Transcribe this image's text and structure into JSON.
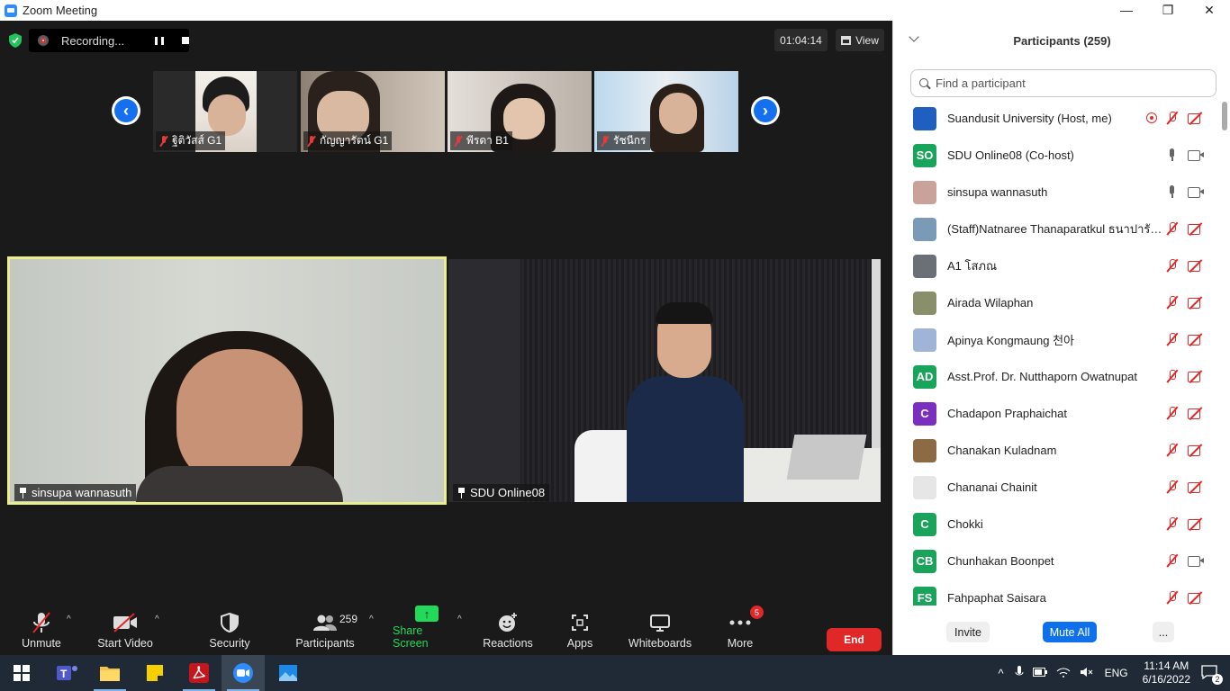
{
  "window": {
    "title": "Zoom Meeting",
    "controls": [
      "—",
      "❐",
      "✕"
    ]
  },
  "meeting": {
    "recording_label": "Recording...",
    "timer": "01:04:14",
    "view_label": "View",
    "thumbnails": [
      {
        "name": "ฐิติวัสส์ G1",
        "muted": true
      },
      {
        "name": "กัญญารัตน์ G1",
        "muted": true
      },
      {
        "name": "พีรดา B1",
        "muted": true
      },
      {
        "name": "รัชนีกร",
        "muted": true
      }
    ],
    "speakers": [
      {
        "name": "sinsupa wannasuth",
        "active": true
      },
      {
        "name": "SDU Online08",
        "active": false
      }
    ]
  },
  "toolbar": {
    "unmute": "Unmute",
    "start_video": "Start Video",
    "security": "Security",
    "participants": "Participants",
    "participants_count": "259",
    "share_screen": "Share Screen",
    "reactions": "Reactions",
    "apps": "Apps",
    "whiteboards": "Whiteboards",
    "more": "More",
    "more_badge": "5",
    "end": "End"
  },
  "panel": {
    "title": "Participants (259)",
    "search_placeholder": "Find a participant",
    "participants": [
      {
        "name": "Suandusit University (Host, me)",
        "initials": "",
        "avatar_color": "#1f5fbf",
        "mic": "off",
        "cam": "off",
        "recording": true
      },
      {
        "name": "SDU Online08 (Co-host)",
        "initials": "SO",
        "avatar_color": "#1aa35a",
        "mic": "on",
        "cam": "on",
        "recording": false
      },
      {
        "name": "sinsupa wannasuth",
        "initials": "",
        "avatar_color": "#c9a39a",
        "mic": "on",
        "cam": "on",
        "recording": false
      },
      {
        "name": "(Staff)Natnaree Thanaparatkul ธนาปารัชต์...",
        "initials": "",
        "avatar_color": "#7a9ab8",
        "mic": "off",
        "cam": "off",
        "recording": false
      },
      {
        "name": "A1 โสภณ",
        "initials": "",
        "avatar_color": "#6b7077",
        "mic": "off",
        "cam": "off",
        "recording": false
      },
      {
        "name": "Airada Wilaphan",
        "initials": "",
        "avatar_color": "#8a8f6b",
        "mic": "off",
        "cam": "off",
        "recording": false
      },
      {
        "name": "Apinya Kongmaung 천아",
        "initials": "",
        "avatar_color": "#9fb4d6",
        "mic": "off",
        "cam": "off",
        "recording": false
      },
      {
        "name": "Asst.Prof. Dr. Nutthaporn Owatnupat",
        "initials": "AD",
        "avatar_color": "#1aa35a",
        "mic": "off",
        "cam": "off",
        "recording": false
      },
      {
        "name": "Chadapon Praphaichat",
        "initials": "C",
        "avatar_color": "#7b2fbe",
        "mic": "off",
        "cam": "off",
        "recording": false
      },
      {
        "name": "Chanakan Kuladnam",
        "initials": "",
        "avatar_color": "#8c6a43",
        "mic": "off",
        "cam": "off",
        "recording": false
      },
      {
        "name": "Chananai Chainit",
        "initials": "",
        "avatar_color": "#e6e6e6",
        "mic": "off",
        "cam": "off",
        "recording": false
      },
      {
        "name": "Chokki",
        "initials": "C",
        "avatar_color": "#1aa35a",
        "mic": "off",
        "cam": "off",
        "recording": false
      },
      {
        "name": "Chunhakan Boonpet",
        "initials": "CB",
        "avatar_color": "#1aa35a",
        "mic": "off",
        "cam": "on",
        "recording": false
      },
      {
        "name": "Fahpaphat Saisara",
        "initials": "FS",
        "avatar_color": "#1aa35a",
        "mic": "off",
        "cam": "off",
        "recording": false
      }
    ],
    "invite": "Invite",
    "mute_all": "Mute All",
    "more": "..."
  },
  "taskbar": {
    "language": "ENG",
    "time": "11:14 AM",
    "date": "6/16/2022",
    "notifications": "2"
  },
  "colors": {
    "accent_blue": "#0e71eb",
    "end_red": "#e02828",
    "share_green": "#23d959",
    "active_speaker_border": "#e8ef8c"
  }
}
